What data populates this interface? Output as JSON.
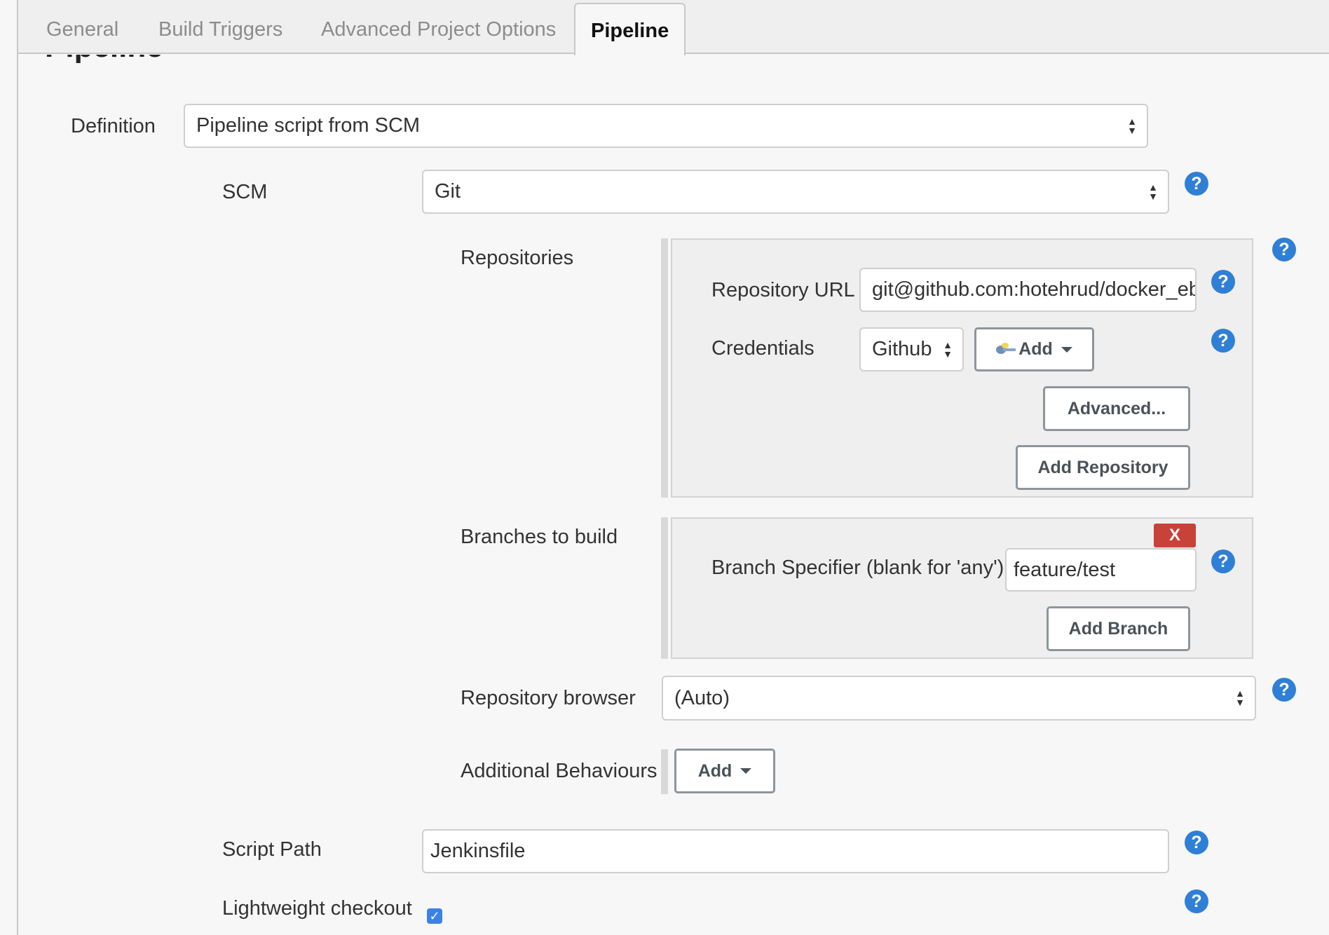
{
  "tabs": [
    {
      "label": "General"
    },
    {
      "label": "Build Triggers"
    },
    {
      "label": "Advanced Project Options"
    },
    {
      "label": "Pipeline"
    }
  ],
  "section_title": "Pipeline",
  "definition": {
    "label": "Definition",
    "value": "Pipeline script from SCM"
  },
  "scm": {
    "label": "SCM",
    "value": "Git"
  },
  "repositories": {
    "label": "Repositories",
    "url_label": "Repository URL",
    "url_value": "git@github.com:hotehrud/docker_eb.git",
    "credentials_label": "Credentials",
    "credentials_value": "Github",
    "add_label": "Add",
    "advanced_label": "Advanced...",
    "add_repository_label": "Add Repository"
  },
  "branches": {
    "label": "Branches to build",
    "delete_label": "X",
    "specifier_label": "Branch Specifier (blank for 'any')",
    "specifier_value": "feature/test",
    "add_branch_label": "Add Branch"
  },
  "repo_browser": {
    "label": "Repository browser",
    "value": "(Auto)"
  },
  "behaviours": {
    "label": "Additional Behaviours",
    "add_label": "Add"
  },
  "script_path": {
    "label": "Script Path",
    "value": "Jenkinsfile"
  },
  "lightweight": {
    "label": "Lightweight checkout",
    "checked": true,
    "check_glyph": "✓"
  },
  "help_glyph": "?",
  "colors": {
    "help": "#2f7fd6",
    "delete": "#c9423a",
    "checkbox": "#3b82e6"
  }
}
